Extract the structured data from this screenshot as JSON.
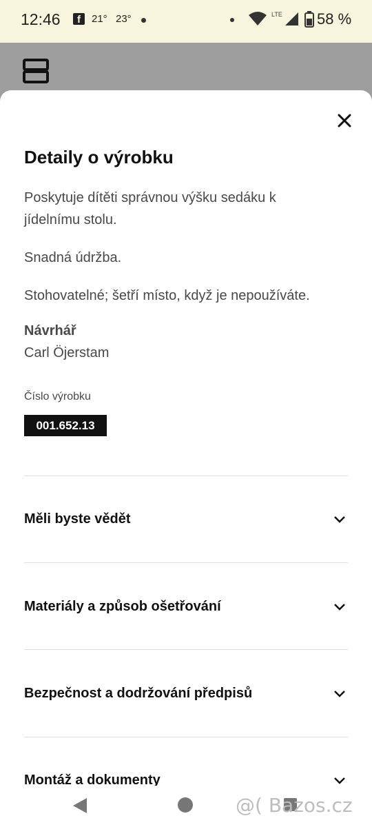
{
  "status_bar": {
    "time": "12:46",
    "facebook_glyph": "f",
    "temp_1": "21°",
    "temp_2": "23°",
    "network_label": "LTE",
    "battery_percent": "58 %"
  },
  "sheet": {
    "title": "Detaily o výrobku",
    "paragraphs": [
      "Poskytuje dítěti správnou výšku sedáku k jídelnímu stolu.",
      "Snadná údržba.",
      "Stohovatelné; šetří místo, když je nepoužíváte."
    ],
    "designer_label": "Návrhář",
    "designer_name": "Carl Öjerstam",
    "article_number_label": "Číslo výrobku",
    "article_number": "001.652.13",
    "accordion": [
      {
        "label": "Měli byste vědět",
        "icon": "chevron-down-icon"
      },
      {
        "label": "Materiály a způsob ošetřování",
        "icon": "chevron-down-icon"
      },
      {
        "label": "Bezpečnost a dodržování předpisů",
        "icon": "chevron-down-icon"
      },
      {
        "label": "Montáž a dokumenty",
        "icon": "chevron-down-icon"
      }
    ]
  },
  "watermark": "@( Bazos.cz",
  "colors": {
    "status_bar_bg": "#f7f5dd",
    "overlay_bg": "#9e9e9e",
    "article_badge_bg": "#111111",
    "text_secondary": "#484848"
  }
}
